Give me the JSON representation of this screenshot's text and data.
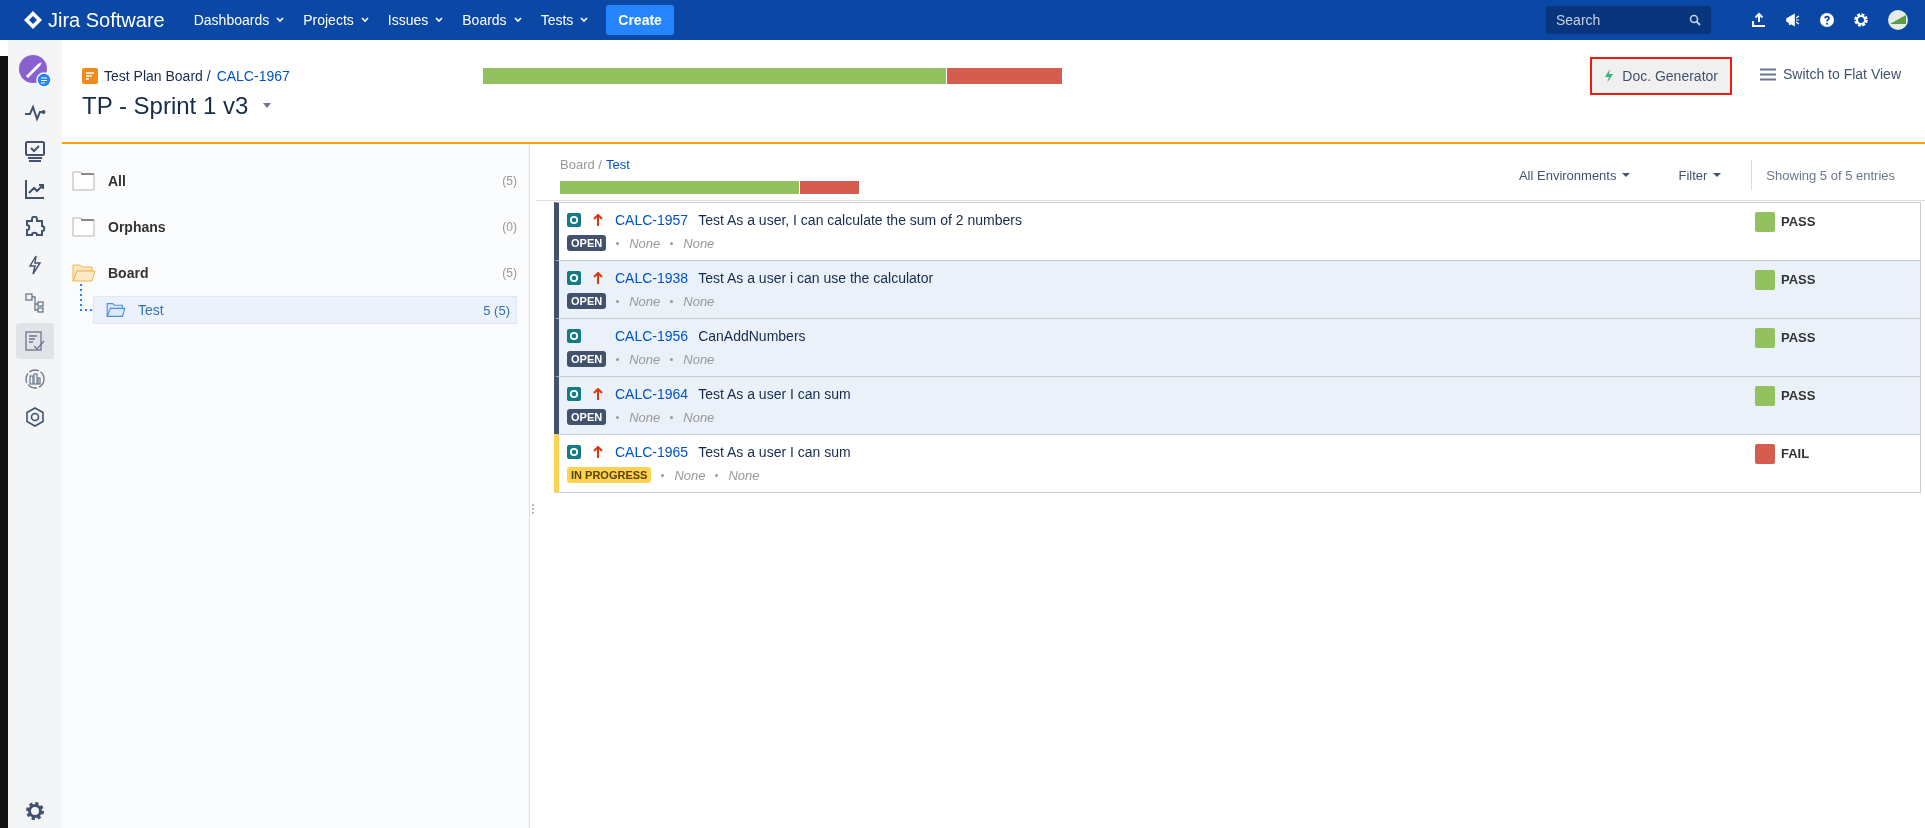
{
  "topbar": {
    "logo": "Jira Software",
    "menu": [
      {
        "label": "Dashboards"
      },
      {
        "label": "Projects"
      },
      {
        "label": "Issues"
      },
      {
        "label": "Boards"
      },
      {
        "label": "Tests"
      }
    ],
    "create": "Create",
    "search": {
      "placeholder": "Search"
    }
  },
  "sidebar": {
    "items": [
      {
        "selected": false
      },
      {
        "selected": false
      },
      {
        "selected": false
      },
      {
        "selected": false
      },
      {
        "selected": false
      },
      {
        "selected": false
      },
      {
        "selected": true
      },
      {
        "selected": false
      },
      {
        "selected": false
      }
    ]
  },
  "header": {
    "breadcrumb": "Test Plan Board /",
    "issue_key": "CALC-1967",
    "title": "TP - Sprint 1 v3",
    "progress": {
      "level": 0.8
    },
    "doc_generator": "Doc. Generator",
    "flat_view": "Switch to Flat View"
  },
  "tree": [
    {
      "label": "All",
      "count": "(5)",
      "expanded": false,
      "selected": false
    },
    {
      "label": "Orphans",
      "count": "(0)",
      "expanded": false,
      "selected": false
    },
    {
      "label": "Board",
      "count": "(5)",
      "expanded": true,
      "selected": false,
      "children": [
        {
          "label": "Test",
          "count": "5 (5)",
          "expanded": true,
          "selected": true
        }
      ]
    }
  ],
  "content": {
    "breadcrumb": "Board /",
    "folder": "Test",
    "progress": {
      "level": 0.8
    },
    "environments": "All Environments",
    "filter": "Filter",
    "showing": "Showing 5 of 5 entries",
    "rows": [
      {
        "key": "CALC-1957",
        "summary": "Test As a user, I can calculate the sum of 2 numbers",
        "high_priority": true,
        "status": "OPEN",
        "kind": "open",
        "fields": [
          "None",
          "None"
        ],
        "result": "PASS",
        "color": "#94c160",
        "selected": false
      },
      {
        "key": "CALC-1938",
        "summary": "Test As a user i can use the calculator",
        "high_priority": true,
        "status": "OPEN",
        "kind": "open",
        "fields": [
          "None",
          "None"
        ],
        "result": "PASS",
        "color": "#94c160",
        "selected": true
      },
      {
        "key": "CALC-1956",
        "summary": "CanAddNumbers",
        "high_priority": false,
        "status": "OPEN",
        "kind": "open",
        "fields": [
          "None",
          "None"
        ],
        "result": "PASS",
        "color": "#94c160",
        "selected": true
      },
      {
        "key": "CALC-1964",
        "summary": "Test As a user I can sum",
        "high_priority": true,
        "status": "OPEN",
        "kind": "open",
        "fields": [
          "None",
          "None"
        ],
        "result": "PASS",
        "color": "#94c160",
        "selected": true
      },
      {
        "key": "CALC-1965",
        "summary": "Test As a user I can sum",
        "high_priority": true,
        "status": "IN PROGRESS",
        "kind": "in_progress",
        "fields": [
          "None",
          "None"
        ],
        "result": "FAIL",
        "color": "#d45d4f",
        "selected": false
      }
    ]
  }
}
